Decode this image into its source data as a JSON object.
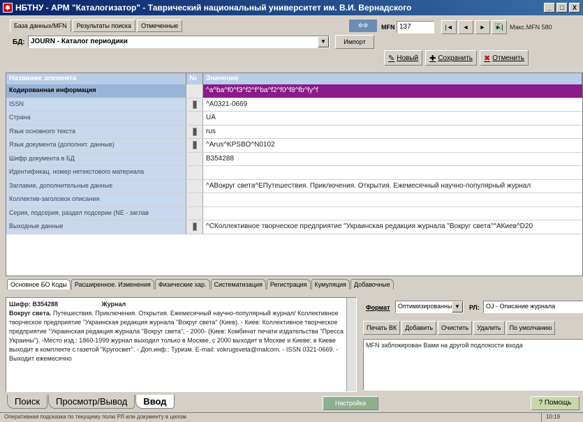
{
  "window": {
    "title": "НБТНУ - АРМ \"Каталогизатор\" - Таврический национальный университет им. В.И. Вернадского",
    "controls": [
      "_",
      "□",
      "X"
    ]
  },
  "top_tabs": [
    {
      "label": "База данных/MFN"
    },
    {
      "label": "Результаты поиска"
    },
    {
      "label": "Отмеченные"
    }
  ],
  "db": {
    "label": "БД:",
    "value": "JOURN - Каталог периодики",
    "import_label": "Импорт"
  },
  "record_nav": {
    "mfn_label": "MFN",
    "mfn_value": "137",
    "buttons": [
      "|◄",
      "◄",
      "►",
      "►|"
    ],
    "max_mfn": "Макс.MFN 580"
  },
  "actions": [
    {
      "icon": "✎",
      "label": "Новый"
    },
    {
      "icon": "✚",
      "label": "Сохранить"
    },
    {
      "icon": "✖",
      "label": "Отменить"
    }
  ],
  "grid": {
    "columns": [
      "Название элемента",
      "№",
      "Значение"
    ],
    "rows": [
      {
        "name": "Кодированная информация",
        "mark": false,
        "value": "^a^ba^f0^f3^f2^f^ba^f2^f0^f8^fb^fy^f",
        "header": true
      },
      {
        "name": "ISSN",
        "mark": true,
        "value": "^A0321-0669"
      },
      {
        "name": "Страна",
        "mark": false,
        "value": "UA"
      },
      {
        "name": "Язык основного текста",
        "mark": true,
        "value": "rus"
      },
      {
        "name": "Язык документа (дополнит. данные)",
        "mark": true,
        "value": "^Arus^KPSBO^N0102"
      },
      {
        "name": "Шифр документа в БД",
        "mark": false,
        "value": "B354288"
      },
      {
        "name": "Идентификац. номер нетекстового материала",
        "mark": false,
        "value": ""
      },
      {
        "name": "Заглавие, дополнительные данные",
        "mark": false,
        "value": "^AВокруг света^EПутешествия. Приключения. Открытия. Ежемесячный научно-популярный журнал"
      },
      {
        "name": "Коллектив-заголовок описания",
        "mark": false,
        "value": ""
      },
      {
        "name": "Серия, подсерия, раздел подсерии (NE - заглав",
        "mark": false,
        "value": ""
      },
      {
        "name": "Выходные данные",
        "mark": true,
        "value": "^CКоллективное творческое предприятие \"Украинская редакция журнала \"Вокруг света\"^AКиев^D20"
      }
    ]
  },
  "sub_tabs": [
    {
      "label": "Основное БО Коды",
      "active": true
    },
    {
      "label": "Расширенное. Изменения"
    },
    {
      "label": "Физические хар."
    },
    {
      "label": "Систематизация"
    },
    {
      "label": "Регистрация"
    },
    {
      "label": "Кумуляция"
    },
    {
      "label": "Добавочные"
    }
  ],
  "description": {
    "shelf": "Шифр: B354288",
    "type": "Журнал",
    "title": "Вокруг света.",
    "text": "Путешествия. Приключения. Открытия. Ежемесячный научно-популярный журнал/ Коллективное творческое предприятие \"Украинская редакция журнала \"Вокруг света\" (Киев). - Киев: Коллективное творческое предприятие \"Украинская редакция журнала \"Вокруг света\", - 2000- (Киев: Комбинат печати издательства \"Пресса Украины\"). -Место изд.: 1860-1999 журнал выходил только в Москве, с 2000 выходит в Москве и Киеве; в Киеве выходит в комплекте с газетой \"Кругосвет\". - Доп.инф.: Туризм. Е-mail: vokrugsveta@malcom. - ISSN 0321-0669. - Выходит ежемесячно"
  },
  "format": {
    "label": "Формат",
    "value": "Оптимизированный",
    "rl_label": "РЛ:",
    "rl_value": "OJ - Описание журнала"
  },
  "right_buttons": [
    "Печать ВК",
    "Добавить",
    "Очистить",
    "Удалить",
    "По умолчанию"
  ],
  "message": "MFN заблокирован Вами на другой подлокости входа",
  "bottom_tabs": [
    {
      "label": "Поиск"
    },
    {
      "label": "Просмотр/Вывод"
    },
    {
      "label": "Ввод",
      "active": true
    }
  ],
  "settings_label": "Настройка",
  "help_label": "? Помощь",
  "status": {
    "hint": "Оперативная подсказка по текущему полю РЛ или документу в целом",
    "time": "10:19"
  }
}
